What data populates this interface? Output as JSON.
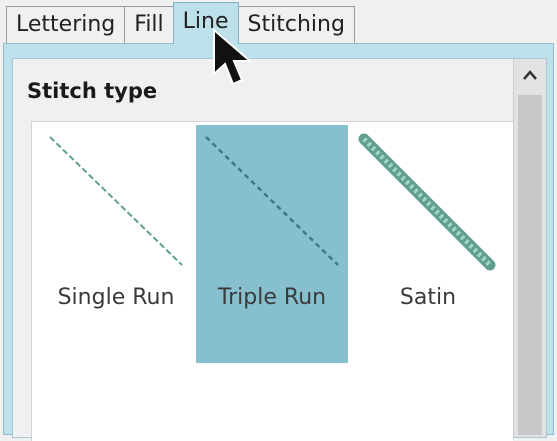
{
  "tabs": [
    {
      "label": "Lettering",
      "active": false
    },
    {
      "label": "Fill",
      "active": false
    },
    {
      "label": "Line",
      "active": true
    },
    {
      "label": "Stitching",
      "active": false
    }
  ],
  "section_title": "Stitch type",
  "stitch_options": [
    {
      "label": "Single Run",
      "icon": "single-run-icon",
      "selected": false
    },
    {
      "label": "Triple Run",
      "icon": "triple-run-icon",
      "selected": true
    },
    {
      "label": "Satin",
      "icon": "satin-icon",
      "selected": false
    }
  ],
  "colors": {
    "active_tab": "#bde0ea",
    "selected_option": "#86c0cf",
    "stitch_line": "#5f9e91",
    "satin_fill": "#7ec4b4"
  },
  "scrollbar": {
    "up_icon": "chevron-up-icon"
  }
}
